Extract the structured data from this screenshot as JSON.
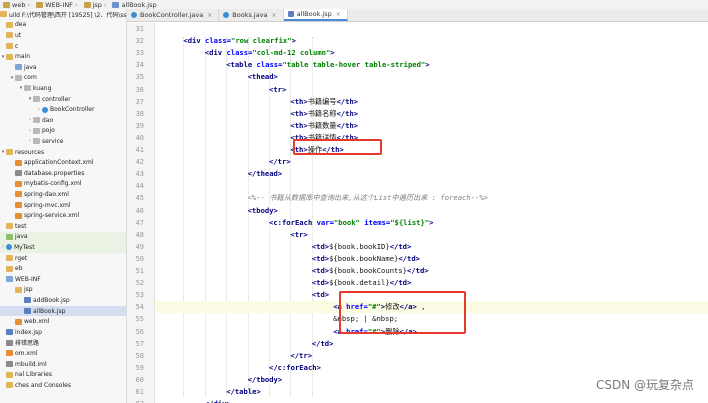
{
  "breadcrumbs": [
    {
      "label": "web",
      "icon": "folder-icon"
    },
    {
      "label": "WEB-INF",
      "icon": "folder-icon"
    },
    {
      "label": "jsp",
      "icon": "folder-icon"
    },
    {
      "label": "allBook.jsp",
      "icon": "jsp-file-icon"
    }
  ],
  "tabs": [
    {
      "label": "BookController.java",
      "icon": "class-icon",
      "active": false
    },
    {
      "label": "Books.java",
      "icon": "class-icon",
      "active": false
    },
    {
      "label": "allBook.jsp",
      "icon": "jsp-file-icon",
      "active": true
    }
  ],
  "tree": [
    {
      "label": "uild F:\\代码管理\\西开 [19525] \\2、代码\\ssm",
      "indent": 0,
      "arrow": "",
      "icon": "folder"
    },
    {
      "label": "dea",
      "indent": 0,
      "arrow": "",
      "icon": "folder"
    },
    {
      "label": "ut",
      "indent": 0,
      "arrow": "",
      "icon": "folder"
    },
    {
      "label": "c",
      "indent": 0,
      "arrow": "",
      "icon": "folder"
    },
    {
      "label": "main",
      "indent": 0,
      "arrow": "▾",
      "icon": "folder"
    },
    {
      "label": "java",
      "indent": 1,
      "arrow": "",
      "icon": "folder-blue"
    },
    {
      "label": "com",
      "indent": 1,
      "arrow": "▾",
      "icon": "pkg"
    },
    {
      "label": "kuang",
      "indent": 2,
      "arrow": "▾",
      "icon": "pkg"
    },
    {
      "label": "controller",
      "indent": 3,
      "arrow": "▾",
      "icon": "pkg"
    },
    {
      "label": "BookController",
      "indent": 4,
      "arrow": "›",
      "icon": "class"
    },
    {
      "label": "dao",
      "indent": 3,
      "arrow": "›",
      "icon": "pkg"
    },
    {
      "label": "pojo",
      "indent": 3,
      "arrow": "›",
      "icon": "pkg"
    },
    {
      "label": "service",
      "indent": 3,
      "arrow": "›",
      "icon": "pkg"
    },
    {
      "label": "resources",
      "indent": 0,
      "arrow": "▾",
      "icon": "folder"
    },
    {
      "label": "applicationContext.xml",
      "indent": 1,
      "arrow": "",
      "icon": "xml"
    },
    {
      "label": "database.properties",
      "indent": 1,
      "arrow": "",
      "icon": "props"
    },
    {
      "label": "mybatis-config.xml",
      "indent": 1,
      "arrow": "",
      "icon": "xml"
    },
    {
      "label": "spring-dao.xml",
      "indent": 1,
      "arrow": "",
      "icon": "xml"
    },
    {
      "label": "spring-mvc.xml",
      "indent": 1,
      "arrow": "",
      "icon": "xml"
    },
    {
      "label": "spring-service.xml",
      "indent": 1,
      "arrow": "",
      "icon": "xml"
    },
    {
      "label": "test",
      "indent": 0,
      "arrow": "",
      "icon": "folder"
    },
    {
      "label": "java",
      "indent": 0,
      "arrow": "",
      "icon": "folder-green",
      "green": true
    },
    {
      "label": "MyTest",
      "indent": 0,
      "arrow": "›",
      "icon": "class",
      "green": true
    },
    {
      "label": "rget",
      "indent": 0,
      "arrow": "",
      "icon": "folder"
    },
    {
      "label": "eb",
      "indent": 0,
      "arrow": "",
      "icon": "folder"
    },
    {
      "label": "WEB-INF",
      "indent": 0,
      "arrow": "",
      "icon": "folder-blue"
    },
    {
      "label": "jsp",
      "indent": 1,
      "arrow": "",
      "icon": "folder"
    },
    {
      "label": "addBook.jsp",
      "indent": 2,
      "arrow": "",
      "icon": "jspf"
    },
    {
      "label": "allBook.jsp",
      "indent": 2,
      "arrow": "",
      "icon": "jspf",
      "selected": true
    },
    {
      "label": "web.xml",
      "indent": 1,
      "arrow": "",
      "icon": "xml"
    },
    {
      "label": "index.jsp",
      "indent": 0,
      "arrow": "",
      "icon": "jspf"
    },
    {
      "label": "排错思路",
      "indent": 0,
      "arrow": "",
      "icon": "props"
    },
    {
      "label": "om.xml",
      "indent": 0,
      "arrow": "",
      "icon": "xml"
    },
    {
      "label": "mbuild.iml",
      "indent": 0,
      "arrow": "",
      "icon": "props"
    },
    {
      "label": "nal Libraries",
      "indent": 0,
      "arrow": "",
      "icon": "folder"
    },
    {
      "label": "ches and Consoles",
      "indent": 0,
      "arrow": "",
      "icon": "folder"
    }
  ],
  "code": [
    {
      "n": "31",
      "indent": 0,
      "parts": []
    },
    {
      "n": "32",
      "indent": 4,
      "parts": [
        [
          "tag",
          "<div "
        ],
        [
          "attr",
          "class="
        ],
        [
          "val",
          "\"row clearfix\""
        ],
        [
          "tag",
          ">"
        ]
      ]
    },
    {
      "n": "33",
      "indent": 8,
      "parts": [
        [
          "tag",
          "<div "
        ],
        [
          "attr",
          "class="
        ],
        [
          "val",
          "\"col-md-12 column\""
        ],
        [
          "tag",
          ">"
        ]
      ]
    },
    {
      "n": "34",
      "indent": 12,
      "parts": [
        [
          "tag",
          "<table "
        ],
        [
          "attr",
          "class="
        ],
        [
          "val",
          "\"table table-hover table-striped\""
        ],
        [
          "tag",
          ">"
        ]
      ]
    },
    {
      "n": "35",
      "indent": 16,
      "parts": [
        [
          "tag",
          "<thead>"
        ]
      ]
    },
    {
      "n": "36",
      "indent": 20,
      "parts": [
        [
          "tag",
          "<tr>"
        ]
      ]
    },
    {
      "n": "37",
      "indent": 24,
      "parts": [
        [
          "tag",
          "<th>"
        ],
        [
          "txt",
          "书籍编号"
        ],
        [
          "tag",
          "</th>"
        ]
      ]
    },
    {
      "n": "38",
      "indent": 24,
      "parts": [
        [
          "tag",
          "<th>"
        ],
        [
          "txt",
          "书籍名称"
        ],
        [
          "tag",
          "</th>"
        ]
      ]
    },
    {
      "n": "39",
      "indent": 24,
      "parts": [
        [
          "tag",
          "<th>"
        ],
        [
          "txt",
          "书籍数量"
        ],
        [
          "tag",
          "</th>"
        ]
      ]
    },
    {
      "n": "40",
      "indent": 24,
      "parts": [
        [
          "tag",
          "<th>"
        ],
        [
          "txt",
          "书籍详情"
        ],
        [
          "tag",
          "</th>"
        ]
      ]
    },
    {
      "n": "41",
      "indent": 24,
      "parts": [
        [
          "tag",
          "<th>"
        ],
        [
          "txt",
          "操作"
        ],
        [
          "tag",
          "</th>"
        ]
      ]
    },
    {
      "n": "42",
      "indent": 20,
      "parts": [
        [
          "tag",
          "</tr>"
        ]
      ]
    },
    {
      "n": "43",
      "indent": 16,
      "parts": [
        [
          "tag",
          "</thead>"
        ]
      ]
    },
    {
      "n": "44",
      "indent": 0,
      "parts": []
    },
    {
      "n": "45",
      "indent": 16,
      "parts": [
        [
          "cmt",
          "<%-- 书籍从数据库中查询出来,从这个List中遍历出来 : foreach--%>"
        ]
      ]
    },
    {
      "n": "46",
      "indent": 16,
      "parts": [
        [
          "tag",
          "<tbody>"
        ]
      ]
    },
    {
      "n": "47",
      "indent": 20,
      "parts": [
        [
          "tag",
          "<c:forEach "
        ],
        [
          "attr",
          "var="
        ],
        [
          "val",
          "\"book\" "
        ],
        [
          "attr",
          "items="
        ],
        [
          "val",
          "\"${list}\""
        ],
        [
          "tag",
          ">"
        ]
      ]
    },
    {
      "n": "48",
      "indent": 24,
      "parts": [
        [
          "tag",
          "<tr>"
        ]
      ]
    },
    {
      "n": "49",
      "indent": 28,
      "parts": [
        [
          "tag",
          "<td>"
        ],
        [
          "txt",
          "${book.bookID}"
        ],
        [
          "tag",
          "</td>"
        ]
      ]
    },
    {
      "n": "50",
      "indent": 28,
      "parts": [
        [
          "tag",
          "<td>"
        ],
        [
          "txt",
          "${book.bookName}"
        ],
        [
          "tag",
          "</td>"
        ]
      ]
    },
    {
      "n": "51",
      "indent": 28,
      "parts": [
        [
          "tag",
          "<td>"
        ],
        [
          "txt",
          "${book.bookCounts}"
        ],
        [
          "tag",
          "</td>"
        ]
      ]
    },
    {
      "n": "52",
      "indent": 28,
      "parts": [
        [
          "tag",
          "<td>"
        ],
        [
          "txt",
          "${book.detail}"
        ],
        [
          "tag",
          "</td>"
        ]
      ]
    },
    {
      "n": "53",
      "indent": 28,
      "parts": [
        [
          "tag",
          "<td>"
        ]
      ]
    },
    {
      "n": "54",
      "indent": 32,
      "parts": [
        [
          "tag",
          "<a "
        ],
        [
          "attr",
          "href="
        ],
        [
          "val",
          "\"#\""
        ],
        [
          "tag",
          ">"
        ],
        [
          "txt",
          "修改"
        ],
        [
          "tag",
          "</a>"
        ],
        [
          "txt",
          " ,"
        ]
      ],
      "current": true
    },
    {
      "n": "55",
      "indent": 32,
      "parts": [
        [
          "ent",
          "&nbsp; | &nbsp;"
        ]
      ]
    },
    {
      "n": "56",
      "indent": 32,
      "parts": [
        [
          "tag",
          "<a "
        ],
        [
          "attr",
          "href="
        ],
        [
          "val",
          "\"#\""
        ],
        [
          "tag",
          ">"
        ],
        [
          "txt",
          "删除"
        ],
        [
          "tag",
          "</a>"
        ]
      ]
    },
    {
      "n": "57",
      "indent": 28,
      "parts": [
        [
          "tag",
          "</td>"
        ]
      ]
    },
    {
      "n": "58",
      "indent": 24,
      "parts": [
        [
          "tag",
          "</tr>"
        ]
      ]
    },
    {
      "n": "59",
      "indent": 20,
      "parts": [
        [
          "tag",
          "</c:forEach>"
        ]
      ]
    },
    {
      "n": "60",
      "indent": 16,
      "parts": [
        [
          "tag",
          "</tbody>"
        ]
      ]
    },
    {
      "n": "61",
      "indent": 12,
      "parts": [
        [
          "tag",
          "</table>"
        ]
      ]
    },
    {
      "n": "62",
      "indent": 8,
      "parts": [
        [
          "tag",
          "</div>"
        ]
      ]
    }
  ],
  "highlight_color": "#e53b2f",
  "watermark": "CSDN @玩复杂点"
}
